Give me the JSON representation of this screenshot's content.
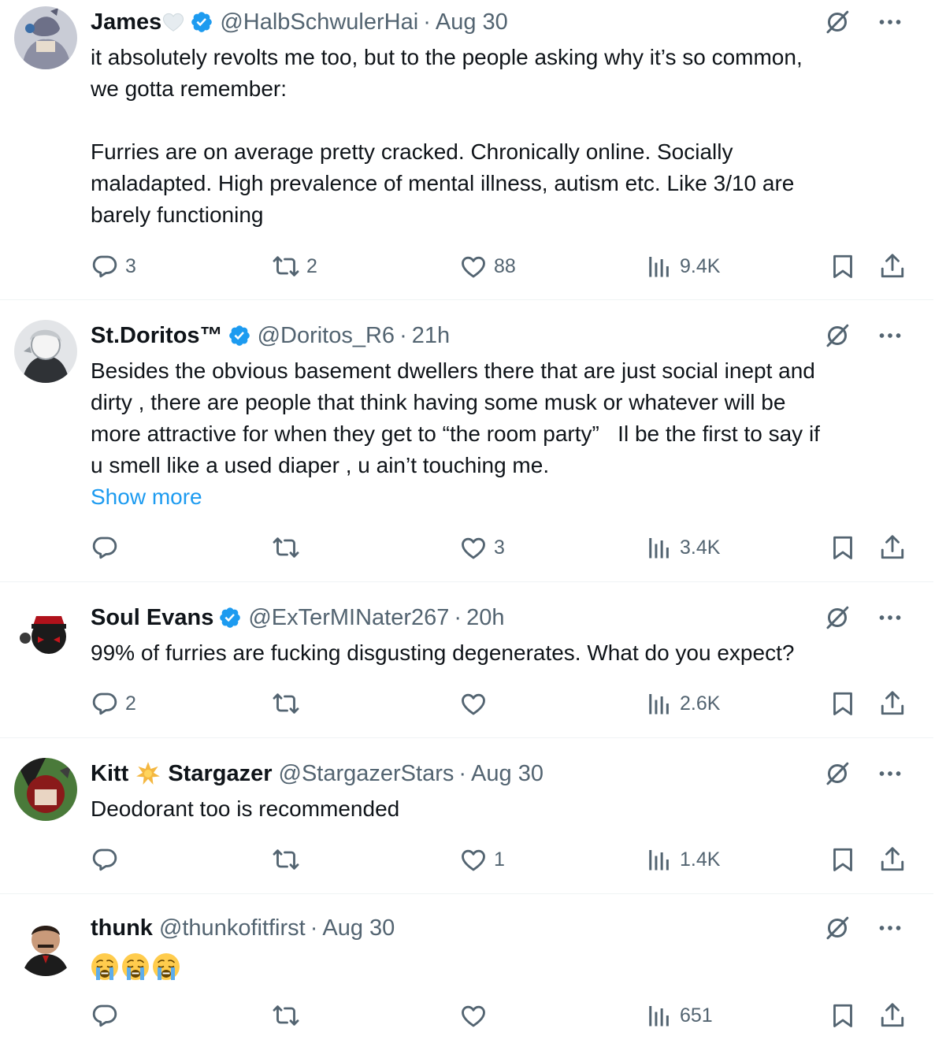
{
  "colors": {
    "text": "#0f1419",
    "muted": "#536471",
    "accent": "#1d9bf0",
    "verified": "#1d9bf0",
    "divider": "#eff3f4"
  },
  "tweets": [
    {
      "name": "James",
      "name_decoration": "white-heart-icon",
      "verified": true,
      "handle": "@HalbSchwulerHai",
      "dot": "·",
      "time": "Aug 30",
      "lines": [
        "it absolutely revolts me too, but to the people asking why it’s so common,",
        "we gotta remember:",
        "",
        "Furries are on average pretty cracked. Chronically online. Socially",
        "maladapted. High prevalence of mental illness, autism etc. Like 3/10 are",
        "barely functioning"
      ],
      "show_more": "",
      "replies": "3",
      "reposts": "2",
      "likes": "88",
      "views": "9.4K"
    },
    {
      "name": "St.Doritos™",
      "verified": true,
      "handle": "@Doritos_R6",
      "dot": "·",
      "time": "21h",
      "lines": [
        "Besides the obvious basement dwellers there that are just social inept and",
        "dirty , there are people that think having some musk or whatever will be",
        "more attractive for when they get to “the room party”   Il be the first to say if",
        "u smell like a used diaper , u ain’t touching me."
      ],
      "show_more": "Show more",
      "replies": "",
      "reposts": "",
      "likes": "3",
      "views": "3.4K"
    },
    {
      "name": "Soul Evans",
      "verified": true,
      "handle": "@ExTerMINater267",
      "dot": "·",
      "time": "20h",
      "lines": [
        "99% of furries are fucking disgusting degenerates. What do you expect?"
      ],
      "show_more": "",
      "replies": "2",
      "reposts": "",
      "likes": "",
      "views": "2.6K"
    },
    {
      "name_first": "Kitt",
      "name_decoration": "sparkle-star-icon",
      "name_last": "Stargazer",
      "verified": false,
      "handle": "@StargazerStars",
      "dot": "·",
      "time": "Aug 30",
      "lines": [
        "Deodorant too is recommended"
      ],
      "show_more": "",
      "replies": "",
      "reposts": "",
      "likes": "1",
      "views": "1.4K"
    },
    {
      "name": "thunk",
      "verified": false,
      "handle": "@thunkofitfirst",
      "dot": "·",
      "time": "Aug 30",
      "emojis": [
        "loudly-crying-face-icon",
        "loudly-crying-face-icon",
        "loudly-crying-face-icon"
      ],
      "show_more": "",
      "replies": "",
      "reposts": "",
      "likes": "",
      "views": "651"
    }
  ]
}
